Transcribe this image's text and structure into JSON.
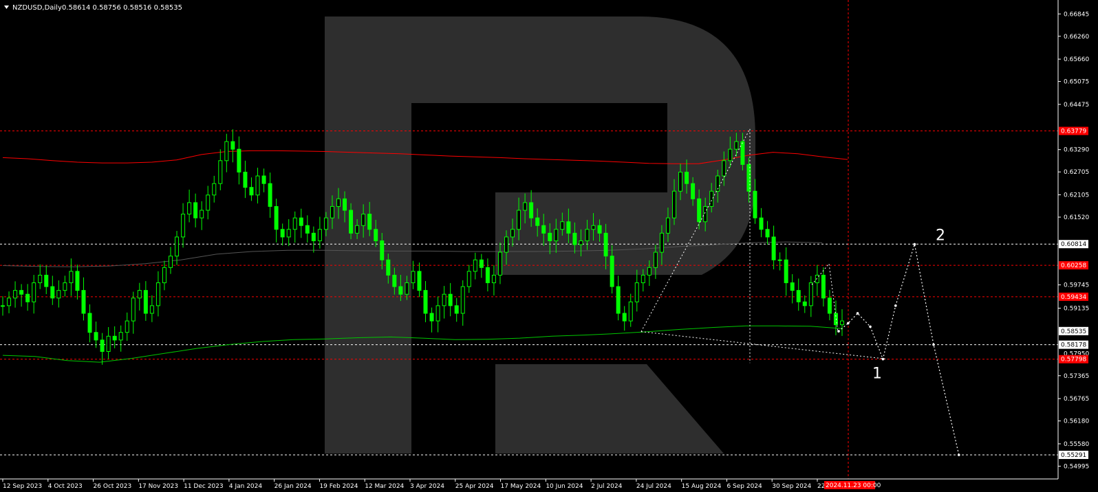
{
  "header": {
    "symbol": "NZDUSD,Daily",
    "ohlc": "0.58614 0.58756 0.58516 0.58535"
  },
  "colors": {
    "background": "#000000",
    "candle": "#00ff00",
    "ma_long": "#ff0000",
    "ma_short": "#00c800",
    "level_red": "#ff0000",
    "level_white": "#ffffff",
    "watermark": "#2e2e2e",
    "price_tag_red": "#ff0000",
    "price_tag_white": "#ffffff"
  },
  "chart_data": {
    "type": "candlestick",
    "symbol": "NZDUSD",
    "timeframe": "Daily",
    "ylim": [
      0.5466,
      0.6721
    ],
    "y_ticks": [
      "0.66845",
      "0.66260",
      "0.65660",
      "0.65075",
      "0.64475",
      "0.63290",
      "0.62705",
      "0.62105",
      "0.61520",
      "0.59745",
      "0.59135",
      "0.57365",
      "0.56765",
      "0.56180",
      "0.55580",
      "0.54995"
    ],
    "x_labels": [
      "12 Sep 2023",
      "4 Oct 2023",
      "26 Oct 2023",
      "17 Nov 2023",
      "11 Dec 2023",
      "4 Jan 2024",
      "26 Jan 2024",
      "19 Feb 2024",
      "12 Mar 2024",
      "3 Apr 2024",
      "25 Apr 2024",
      "17 May 2024",
      "10 Jun 2024",
      "2 Jul 2024",
      "24 Jul 2024",
      "15 Aug 2024",
      "6 Sep 2024",
      "30 Sep 2024",
      "22 Oct 2024"
    ],
    "current_time_label": "2024.11.23 00:00",
    "levels": [
      {
        "value": "0.63779",
        "style": "red-dashed",
        "tag": "red"
      },
      {
        "value": "0.60814",
        "style": "white-dashed",
        "tag": "white"
      },
      {
        "value": "0.60258",
        "style": "red-dashed",
        "tag": "red"
      },
      {
        "value": "0.59434",
        "style": "red-dashed",
        "tag": "red"
      },
      {
        "value": "0.58535",
        "style": "none",
        "tag": "white"
      },
      {
        "value": "0.58178",
        "style": "white-dashed",
        "tag": "white"
      },
      {
        "value": "0.57950",
        "style": "none",
        "tag": "white-plain"
      },
      {
        "value": "0.57798",
        "style": "red-dashed",
        "tag": "red"
      },
      {
        "value": "0.55291",
        "style": "white-dashed",
        "tag": "white"
      }
    ],
    "candles_close_path": [
      0.592,
      0.594,
      0.596,
      0.595,
      0.593,
      0.598,
      0.6,
      0.597,
      0.594,
      0.596,
      0.598,
      0.601,
      0.596,
      0.59,
      0.585,
      0.583,
      0.58,
      0.584,
      0.583,
      0.585,
      0.588,
      0.594,
      0.596,
      0.59,
      0.592,
      0.598,
      0.602,
      0.605,
      0.61,
      0.616,
      0.619,
      0.615,
      0.617,
      0.621,
      0.624,
      0.63,
      0.635,
      0.633,
      0.627,
      0.623,
      0.621,
      0.626,
      0.624,
      0.618,
      0.612,
      0.61,
      0.612,
      0.615,
      0.613,
      0.611,
      0.609,
      0.612,
      0.615,
      0.618,
      0.62,
      0.617,
      0.611,
      0.613,
      0.616,
      0.612,
      0.609,
      0.604,
      0.6,
      0.597,
      0.595,
      0.598,
      0.601,
      0.596,
      0.59,
      0.588,
      0.592,
      0.595,
      0.592,
      0.59,
      0.597,
      0.601,
      0.604,
      0.602,
      0.598,
      0.6,
      0.606,
      0.61,
      0.612,
      0.617,
      0.619,
      0.615,
      0.613,
      0.611,
      0.609,
      0.612,
      0.614,
      0.611,
      0.608,
      0.609,
      0.612,
      0.613,
      0.611,
      0.605,
      0.597,
      0.59,
      0.588,
      0.593,
      0.598,
      0.6,
      0.602,
      0.606,
      0.611,
      0.615,
      0.622,
      0.627,
      0.624,
      0.62,
      0.614,
      0.618,
      0.622,
      0.626,
      0.63,
      0.633,
      0.635,
      0.629,
      0.622,
      0.615,
      0.612,
      0.61,
      0.604,
      0.604,
      0.598,
      0.596,
      0.593,
      0.592,
      0.598,
      0.6,
      0.594,
      0.59,
      0.587,
      0.588
    ],
    "ma_long_path": [
      0.6308,
      0.6305,
      0.63,
      0.6296,
      0.6294,
      0.6294,
      0.6296,
      0.6302,
      0.6316,
      0.6324,
      0.6326,
      0.6326,
      0.6325,
      0.6324,
      0.6322,
      0.632,
      0.6318,
      0.6315,
      0.6312,
      0.631,
      0.6308,
      0.6305,
      0.6303,
      0.6301,
      0.6299,
      0.6296,
      0.6293,
      0.6292,
      0.6292,
      0.6302,
      0.6314,
      0.6322,
      0.6318,
      0.631,
      0.6303
    ],
    "ma_short_path": [
      0.579,
      0.5787,
      0.5776,
      0.5772,
      0.5782,
      0.5795,
      0.5808,
      0.5818,
      0.5826,
      0.5831,
      0.5833,
      0.5836,
      0.5838,
      0.5835,
      0.5831,
      0.5832,
      0.5835,
      0.584,
      0.5843,
      0.5847,
      0.5852,
      0.5858,
      0.5863,
      0.5867,
      0.5867,
      0.5866,
      0.586
    ],
    "ma_mid_path": [
      0.6025,
      0.6023,
      0.6022,
      0.6024,
      0.603,
      0.604,
      0.6055,
      0.6062,
      0.6065,
      0.6065,
      0.6064,
      0.6063,
      0.6063,
      0.6062,
      0.6062,
      0.6062,
      0.6063,
      0.6065,
      0.6069,
      0.6075,
      0.608,
      0.6085,
      0.6087,
      0.6085
    ],
    "wave_labels": [
      "1",
      "2"
    ],
    "forecast_path": [
      {
        "x": "2024-11-22",
        "y": 0.5853
      },
      {
        "x": "2024-11-25",
        "y": 0.5874
      },
      {
        "x": "2024-11-28",
        "y": 0.59
      },
      {
        "x": "2024-12-02",
        "y": 0.5865
      },
      {
        "x": "2024-12-06",
        "y": 0.578
      },
      {
        "x": "2024-12-10",
        "y": 0.592
      },
      {
        "x": "2024-12-16",
        "y": 0.6081
      },
      {
        "x": "2024-12-22",
        "y": 0.5818
      },
      {
        "x": "2024-12-30",
        "y": 0.5529
      }
    ]
  }
}
